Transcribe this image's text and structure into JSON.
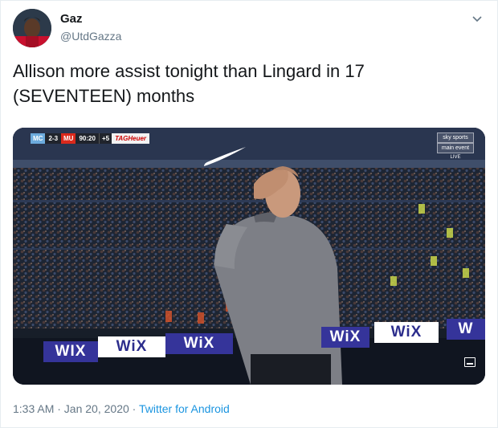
{
  "tweet": {
    "display_name": "Gaz",
    "handle": "@UtdGazza",
    "text": "Allison more assist tonight than Lingard in 17 (SEVENTEEN) months",
    "timestamp": "1:33 AM · Jan 20, 2020",
    "separator": " · ",
    "source": "Twitter for Android"
  },
  "media": {
    "scorebug": {
      "home": "MC",
      "score": "2-3",
      "away": "MU",
      "clock": "90:20",
      "added": "+5",
      "sponsor": "TAGHeuer"
    },
    "broadcaster": {
      "logo": "sky sports",
      "channel": "main event",
      "live": "LIVE"
    },
    "ad_boards": [
      "WIX",
      "WiX",
      "WiX",
      "WiX",
      "WiX",
      "W"
    ]
  },
  "colors": {
    "link": "#1b95e0",
    "secondary_text": "#657786",
    "board_blue": "#35349a"
  },
  "icons": {
    "caret": "chevron-down-icon",
    "expand": "expand-icon"
  }
}
